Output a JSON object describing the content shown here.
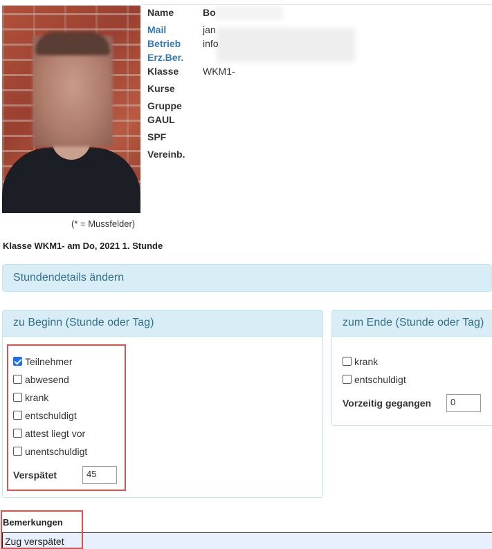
{
  "student": {
    "labels": {
      "name": "Name",
      "mail": "Mail",
      "betrieb": "Betrieb",
      "erzber": "Erz.Ber.",
      "klasse": "Klasse",
      "kurse": "Kurse",
      "gruppe": "Gruppe",
      "gaul": "GAUL",
      "spf": "SPF",
      "vereinb": "Vereinb."
    },
    "values": {
      "name": "Bo",
      "mail": "jan",
      "betrieb": "info",
      "klasse": "WKM1-"
    }
  },
  "mussfelder_note": "(* = Mussfelder)",
  "lesson_title": "Klasse WKM1- am Do, 2021 1. Stunde",
  "panel_stundendetails": "Stundendetails ändern",
  "beginn": {
    "title": "zu Beginn (Stunde oder Tag)",
    "options": [
      {
        "label": "Teilnehmer",
        "checked": true
      },
      {
        "label": "abwesend",
        "checked": false
      },
      {
        "label": "krank",
        "checked": false
      },
      {
        "label": "entschuldigt",
        "checked": false
      },
      {
        "label": "attest liegt vor",
        "checked": false
      },
      {
        "label": "unentschuldigt",
        "checked": false
      }
    ],
    "verspaetet_label": "Verspätet",
    "verspaetet_value": "45"
  },
  "ende": {
    "title": "zum Ende (Stunde oder Tag)",
    "options": [
      {
        "label": "krank",
        "checked": false
      },
      {
        "label": "entschuldigt",
        "checked": false
      }
    ],
    "vorzeitig_label": "Vorzeitig gegangen",
    "vorzeitig_value": "0"
  },
  "bemerkungen": {
    "label": "Bemerkungen",
    "value": "Zug verspätet"
  },
  "colors": {
    "panel_bg": "#d9edf7",
    "panel_border": "#bce8f1",
    "panel_text": "#31708f",
    "link": "#337ab7",
    "highlight": "#e0504f",
    "checkbox_checked": "#1a73e8"
  }
}
